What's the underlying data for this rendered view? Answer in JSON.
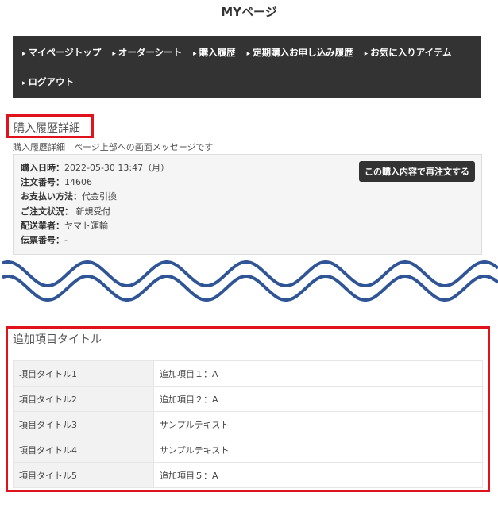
{
  "page_title": "MYページ",
  "nav": [
    "マイページトップ",
    "オーダーシート",
    "購入履歴",
    "定期購入お申し込み履歴",
    "お気に入りアイテム",
    "ログアウト"
  ],
  "heading": "購入履歴詳細",
  "message": "購入履歴詳細　ページ上部への画面メッセージです",
  "order": {
    "rows": [
      {
        "label": "購入日時：",
        "value": "2022-05-30 13:47（月）"
      },
      {
        "label": "注文番号：",
        "value": "14606"
      },
      {
        "label": "お支払い方法：",
        "value": "代金引換"
      },
      {
        "label": "ご注文状況：",
        "value": " 新規受付"
      },
      {
        "label": "配送業者：",
        "value": "ヤマト運輸"
      },
      {
        "label": "伝票番号：",
        "value": "-"
      }
    ],
    "reorder_label": "この購入内容で再注文する"
  },
  "wave_color": "#2f5597",
  "highlight_color": "#e0121e",
  "additional": {
    "title": "追加項目タイトル",
    "rows": [
      {
        "k": "項目タイトル1",
        "v": "追加項目１：A"
      },
      {
        "k": "項目タイトル2",
        "v": "追加項目２：A"
      },
      {
        "k": "項目タイトル3",
        "v": "サンプルテキスト"
      },
      {
        "k": "項目タイトル4",
        "v": "サンプルテキスト"
      },
      {
        "k": "項目タイトル5",
        "v": "追加項目５：A"
      }
    ]
  }
}
